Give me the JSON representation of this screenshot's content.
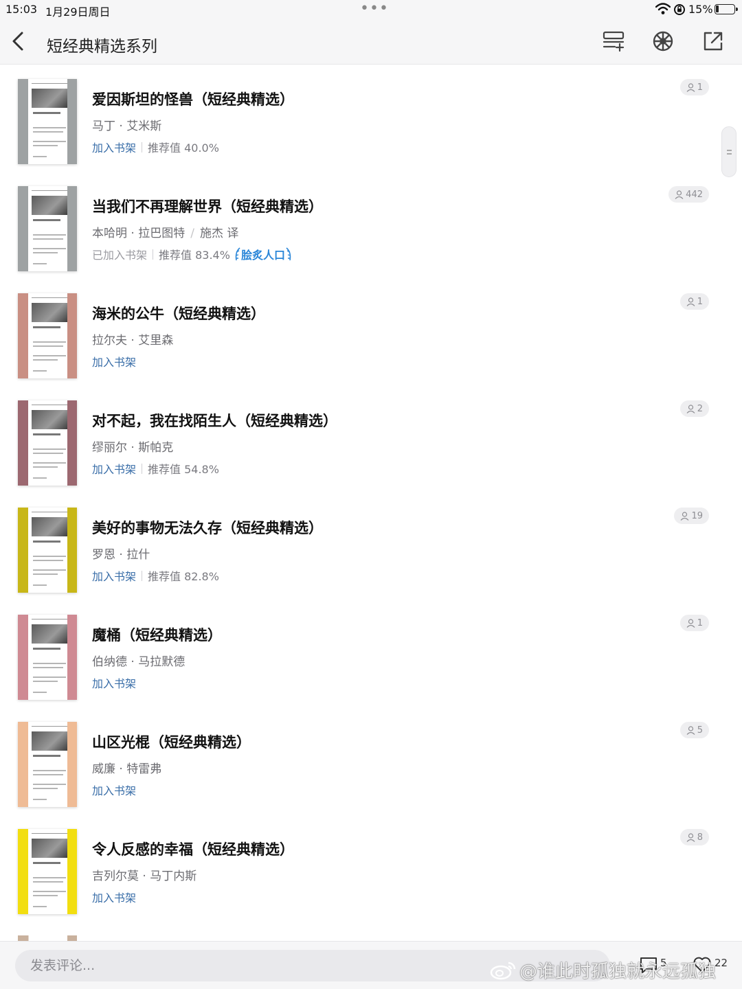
{
  "status_bar": {
    "time": "15:03",
    "date": "1月29日周日",
    "dots": "•••",
    "battery": "15%"
  },
  "nav": {
    "title": "短经典精选系列",
    "icons": [
      "back-chevron-icon",
      "list-add-icon",
      "share-circle-icon",
      "external-share-icon"
    ]
  },
  "books": [
    {
      "title": "爱因斯坦的怪兽（短经典精选）",
      "author": "马丁 · 艾米斯",
      "translator": "",
      "shelf": "加入书架",
      "shelf_added": false,
      "recommend": "推荐值 40.0%",
      "badge": "",
      "readers": "1",
      "spine_color": "#9ea2a3"
    },
    {
      "title": "当我们不再理解世界（短经典精选）",
      "author": "本哈明 · 拉巴图特",
      "translator": "施杰 译",
      "shelf": "已加入书架",
      "shelf_added": true,
      "recommend": "推荐值 83.4%",
      "badge": "脍炙人口",
      "readers": "442",
      "spine_color": "#9ea2a3"
    },
    {
      "title": "海米的公牛（短经典精选）",
      "author": "拉尔夫 · 艾里森",
      "translator": "",
      "shelf": "加入书架",
      "shelf_added": false,
      "recommend": "",
      "badge": "",
      "readers": "1",
      "spine_color": "#c98f83"
    },
    {
      "title": "对不起，我在找陌生人（短经典精选）",
      "author": "缪丽尔 · 斯帕克",
      "translator": "",
      "shelf": "加入书架",
      "shelf_added": false,
      "recommend": "推荐值 54.8%",
      "badge": "",
      "readers": "2",
      "spine_color": "#9c6870"
    },
    {
      "title": "美好的事物无法久存（短经典精选）",
      "author": "罗恩 · 拉什",
      "translator": "",
      "shelf": "加入书架",
      "shelf_added": false,
      "recommend": "推荐值 82.8%",
      "badge": "",
      "readers": "19",
      "spine_color": "#c8b718"
    },
    {
      "title": "魔桶（短经典精选）",
      "author": "伯纳德 · 马拉默德",
      "translator": "",
      "shelf": "加入书架",
      "shelf_added": false,
      "recommend": "",
      "badge": "",
      "readers": "1",
      "spine_color": "#cf8a93"
    },
    {
      "title": "山区光棍（短经典精选）",
      "author": "威廉 · 特雷弗",
      "translator": "",
      "shelf": "加入书架",
      "shelf_added": false,
      "recommend": "",
      "badge": "",
      "readers": "5",
      "spine_color": "#efbb95"
    },
    {
      "title": "令人反感的幸福（短经典精选）",
      "author": "吉列尔莫 · 马丁内斯",
      "translator": "",
      "shelf": "加入书架",
      "shelf_added": false,
      "recommend": "",
      "badge": "",
      "readers": "8",
      "spine_color": "#f2de10"
    }
  ],
  "bottom": {
    "comment_placeholder": "发表评论...",
    "comment_count": "5",
    "like_count": "22",
    "watermark": "@谁此时孤独就永远孤独"
  }
}
